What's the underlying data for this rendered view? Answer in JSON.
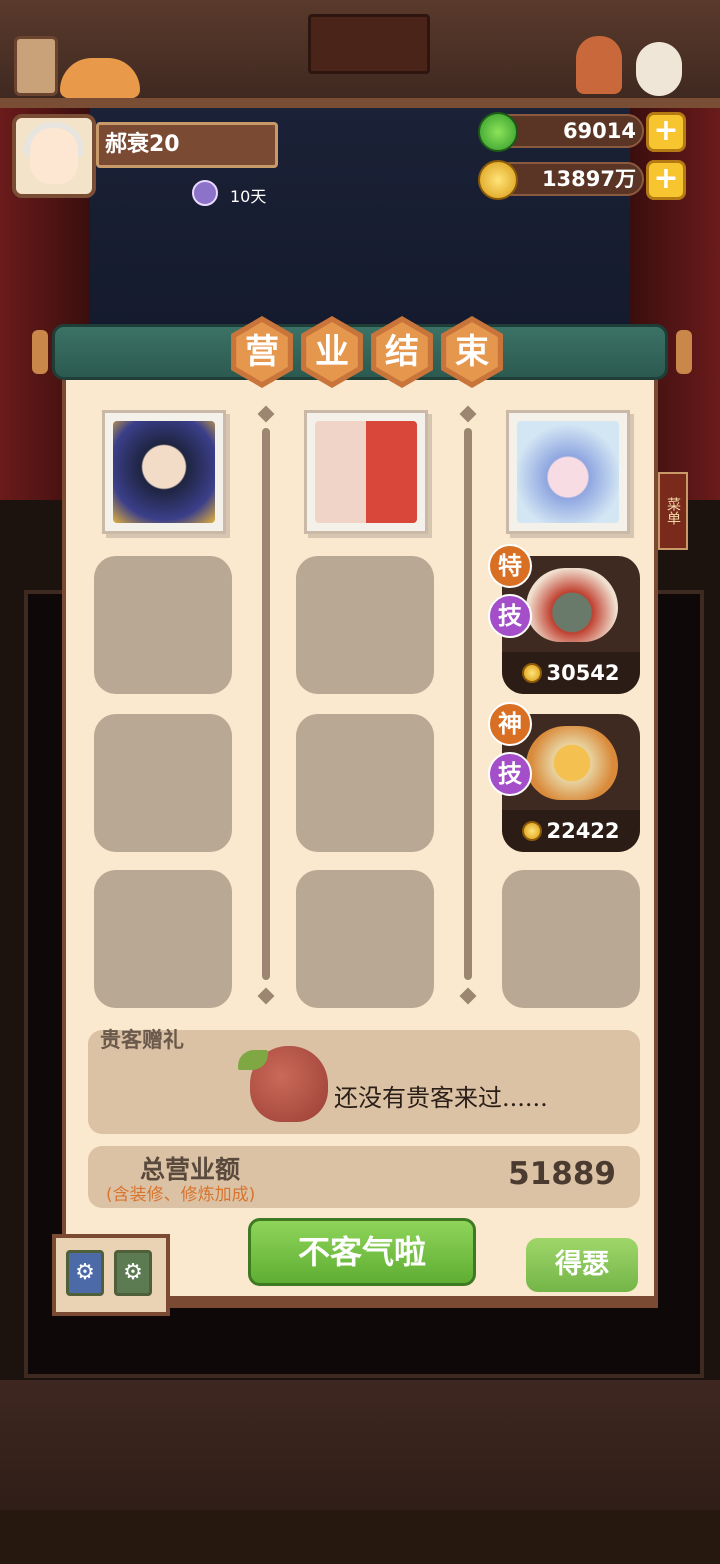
{
  "player": {
    "name": "郝衰20",
    "days": "10天"
  },
  "currency": {
    "jade": "69014",
    "coins": "13897万",
    "plus_symbol": "+"
  },
  "side_menu": {
    "label": "菜单"
  },
  "panel": {
    "title_chars": [
      "营",
      "业",
      "结",
      "束"
    ],
    "columns": [
      {
        "dishes": [],
        "empty_slots": 3
      },
      {
        "dishes": [],
        "empty_slots": 3
      },
      {
        "dishes": [
          {
            "badge_top": "特",
            "badge_bottom": "技",
            "price": "30542"
          },
          {
            "badge_top": "神",
            "badge_bottom": "技",
            "price": "22422"
          }
        ],
        "empty_slots": 1
      }
    ],
    "gift": {
      "title": "贵客赠礼",
      "message": "还没有贵客来过......"
    },
    "total": {
      "label": "总营业额",
      "sublabel": "(含装修、修炼加成)",
      "value": "51889"
    },
    "buttons": {
      "confirm": "不客气啦",
      "show_off": "得瑟"
    }
  },
  "colors": {
    "panel_bg": "#fbe9cf",
    "title_hex": "#e6974e",
    "confirm_green": "#5fae33"
  }
}
